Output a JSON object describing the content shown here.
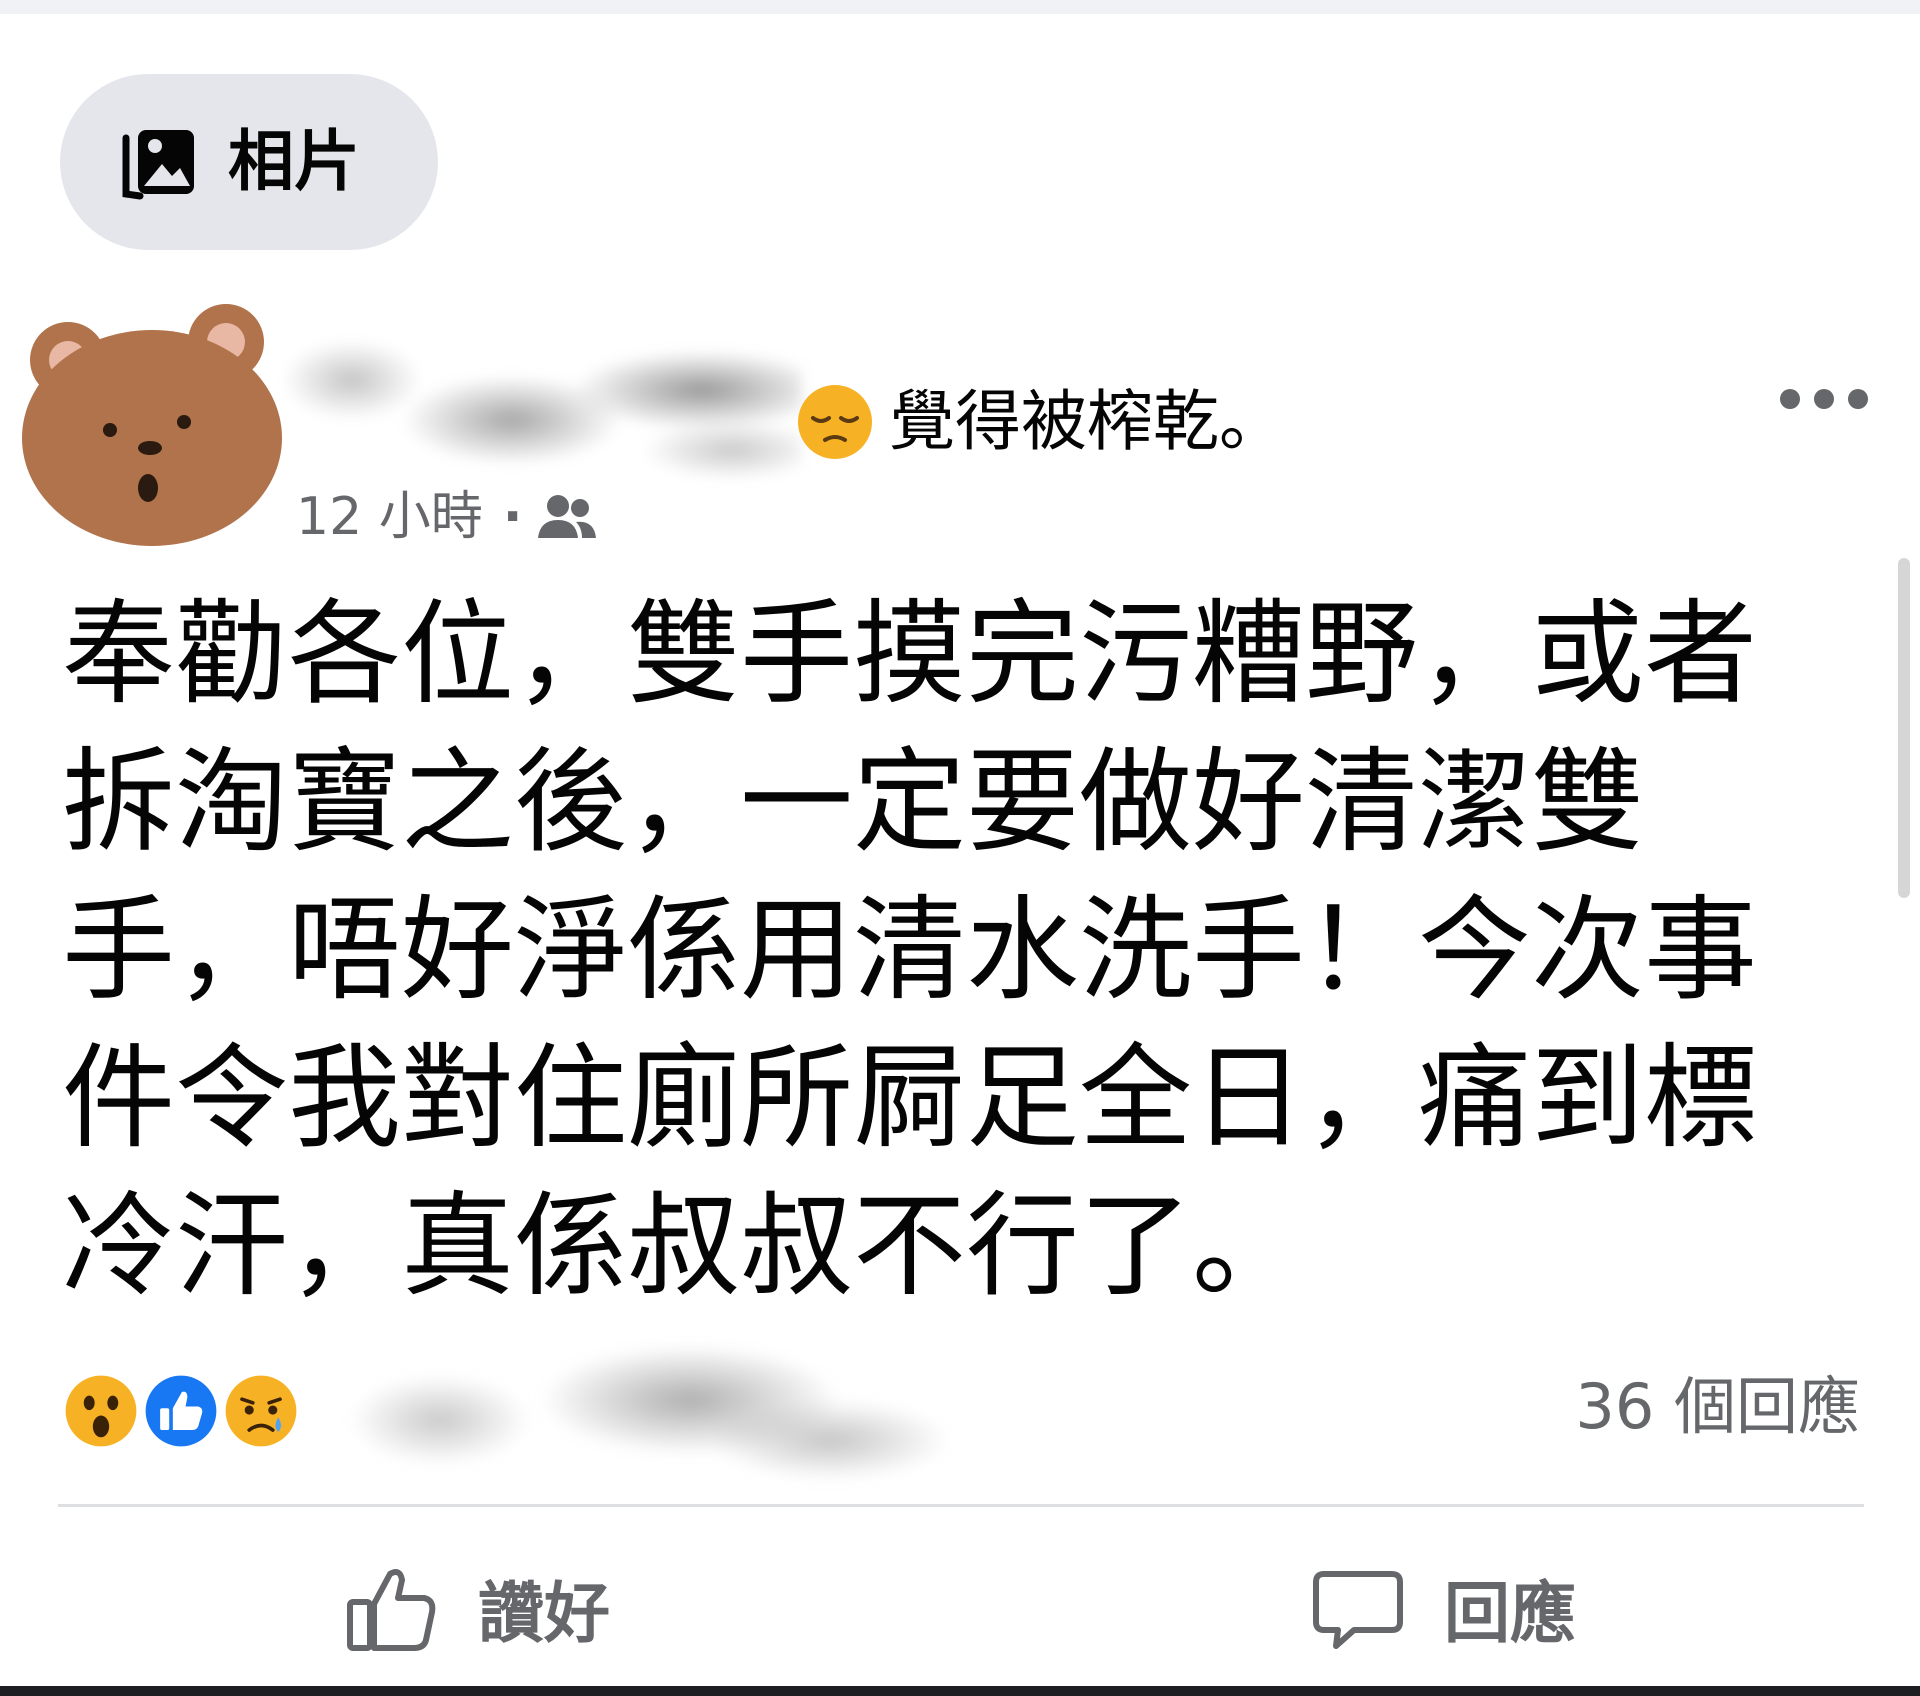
{
  "photos_chip": {
    "label": "相片"
  },
  "post": {
    "feeling_emoji": "pensive-face-icon",
    "feeling_text": "覺得被榨乾。",
    "timestamp": "12 小時",
    "separator": "·",
    "audience": "friends-icon",
    "body_lines": [
      "奉勸各位，雙手摸完污糟野，或者",
      "拆淘寶之後，一定要做好清潔雙",
      "手，唔好淨係用清水洗手！今次事",
      "件令我對住廁所屙足全日，痛到標",
      "冷汗，真係叔叔不行了。"
    ]
  },
  "reactions": {
    "icons": [
      "wow-reaction-icon",
      "like-reaction-icon",
      "sad-reaction-icon"
    ],
    "comment_count": "36 個回應"
  },
  "actions": {
    "like_label": "讚好",
    "comment_label": "回應"
  },
  "colors": {
    "background": "#ffffff",
    "chip_bg": "#e4e6eb",
    "secondary_text": "#65676b",
    "like_blue": "#1877f2",
    "reaction_yellow": "#f7b125"
  }
}
